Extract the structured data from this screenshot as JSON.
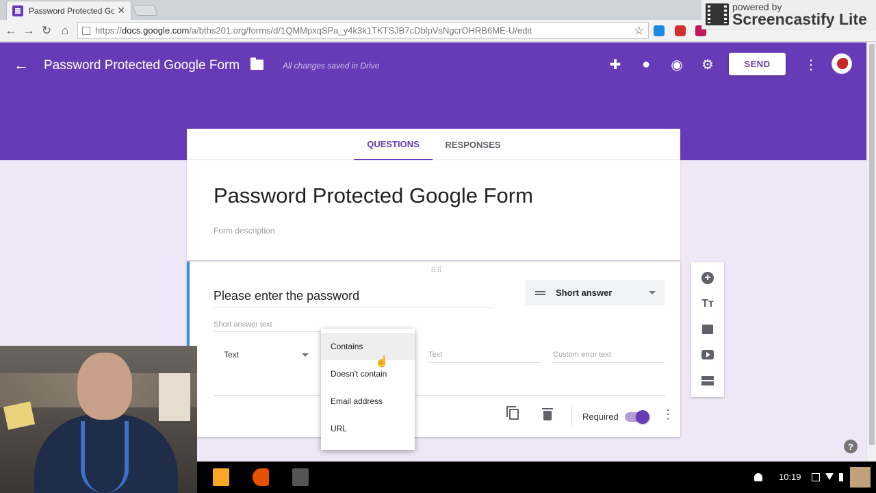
{
  "browser": {
    "tab_title": "Password Protected Goo",
    "tab_close": "✕",
    "url_prefix": "https://",
    "url_domain": "docs.google.com",
    "url_path": "/a/bths201.org/forms/d/1QMMpxqSPa_y4k3k1TKTSJB7cDblpVsNgcrOHRB6ME-U/edit"
  },
  "watermark": {
    "powered_by": "powered by",
    "name": "Screencastify Lite"
  },
  "header": {
    "title": "Password Protected Google Form",
    "saved_status": "All changes saved in Drive",
    "send_label": "SEND"
  },
  "tabs": {
    "questions": "QUESTIONS",
    "responses": "RESPONSES"
  },
  "form": {
    "title": "Password Protected Google Form",
    "description_placeholder": "Form description"
  },
  "question": {
    "title": "Please enter the password",
    "type": "Short answer",
    "answer_placeholder": "Short answer text",
    "validation_type": "Text",
    "validation_value_placeholder": "Text",
    "custom_error_placeholder": "Custom error text",
    "required_label": "Required",
    "required": true
  },
  "dropdown": {
    "options": [
      "Contains",
      "Doesn't contain",
      "Email address",
      "URL"
    ],
    "highlighted": "Contains"
  },
  "side_tools": [
    "add-question-icon",
    "add-title-icon",
    "add-image-icon",
    "add-video-icon",
    "add-section-icon"
  ],
  "shelf": {
    "time": "10:19"
  },
  "colors": {
    "brand": "#673ab7",
    "accent_light": "#b39ddb",
    "background": "#ede7f6",
    "focus_border": "#4285f4"
  }
}
